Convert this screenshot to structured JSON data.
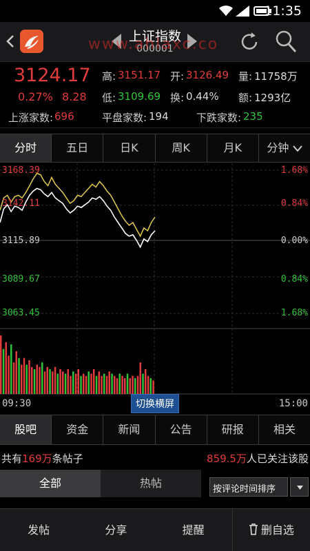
{
  "status": {
    "time": "11:35"
  },
  "header": {
    "back_icon": "chevron-left-icon",
    "title": "上证指数",
    "code": "000001",
    "watermark": "www.ahlaxc.co"
  },
  "quote": {
    "price": "3124.17",
    "change_pct": "0.27%",
    "change": "8.28",
    "high_label": "高:",
    "high": "3151.17",
    "open_label": "开:",
    "open": "3126.49",
    "vol_label": "量:",
    "vol": "11758万",
    "low_label": "低:",
    "low": "3109.69",
    "turnover_label": "换:",
    "turnover": "0.44%",
    "amount_label": "额:",
    "amount": "1293亿",
    "up_label": "上涨家数:",
    "up": "696",
    "flat_label": "平盘家数:",
    "flat": "194",
    "down_label": "下跌家数:",
    "down": "235"
  },
  "period_tabs": [
    "分时",
    "五日",
    "日K",
    "周K",
    "月K",
    "分钟"
  ],
  "chart": {
    "y_left": [
      "3168.39",
      "3142.11",
      "3115.89",
      "3089.67",
      "3063.45"
    ],
    "y_right": [
      "1.68%",
      "0.84%",
      "0.00%",
      "0.84%",
      "1.68%"
    ],
    "x_start": "09:30",
    "x_end": "15:00",
    "landscape_button": "切换横屏"
  },
  "chart_data": {
    "type": "line",
    "title": "",
    "ylim": [
      3063.45,
      3168.39
    ],
    "series": [
      {
        "values": [
          3139,
          3148,
          3150,
          3145,
          3149,
          3150,
          3148,
          3152,
          3157,
          3162,
          3166,
          3165,
          3160,
          3157,
          3163,
          3158,
          3155,
          3152,
          3148,
          3144,
          3146,
          3150,
          3149,
          3152,
          3155,
          3158,
          3156,
          3160,
          3157,
          3153,
          3150,
          3145,
          3140,
          3135,
          3131,
          3128,
          3130,
          3125,
          3120,
          3126,
          3124,
          3130,
          3134
        ]
      },
      {
        "values": [
          3130,
          3140,
          3143,
          3138,
          3142,
          3141,
          3139,
          3145,
          3150,
          3153,
          3155,
          3154,
          3151,
          3149,
          3152,
          3148,
          3146,
          3144,
          3140,
          3137,
          3139,
          3142,
          3141,
          3143,
          3145,
          3148,
          3147,
          3149,
          3146,
          3142,
          3139,
          3134,
          3130,
          3126,
          3122,
          3120,
          3121,
          3117,
          3112,
          3118,
          3116,
          3121,
          3124
        ]
      }
    ],
    "volume": [
      26,
      20,
      23,
      17,
      22,
      14,
      19,
      16,
      13,
      16,
      13,
      15,
      12,
      11,
      13,
      12,
      14,
      10,
      12,
      11,
      10,
      12,
      9,
      11,
      10,
      9,
      11,
      8,
      10,
      9,
      11,
      8,
      9,
      8,
      10,
      9,
      11,
      8,
      10,
      8,
      9,
      8,
      10,
      9,
      8,
      7,
      9,
      8,
      7,
      9,
      7,
      8,
      7,
      8,
      14,
      9,
      11,
      8,
      7,
      6
    ]
  },
  "content_tabs": [
    "股吧",
    "资金",
    "新闻",
    "公告",
    "研报",
    "相关"
  ],
  "forum": {
    "posts_prefix": "共有",
    "posts_count": "169万",
    "posts_suffix": "条帖子",
    "followers_count": "859.5万",
    "followers_suffix": "人已关注该股"
  },
  "filter": {
    "all": "全部",
    "hot": "热帖",
    "sort": "按评论时间排序"
  },
  "bottom": {
    "post": "发帖",
    "share": "分享",
    "remind": "提醒",
    "remove": "删自选"
  },
  "colors": {
    "up": "#e23b3b",
    "down": "#31c43b",
    "price_line": "#ffffff",
    "avg_line": "#d8c24a",
    "logo": "#e8582e",
    "accent_button": "#1f4f93"
  }
}
